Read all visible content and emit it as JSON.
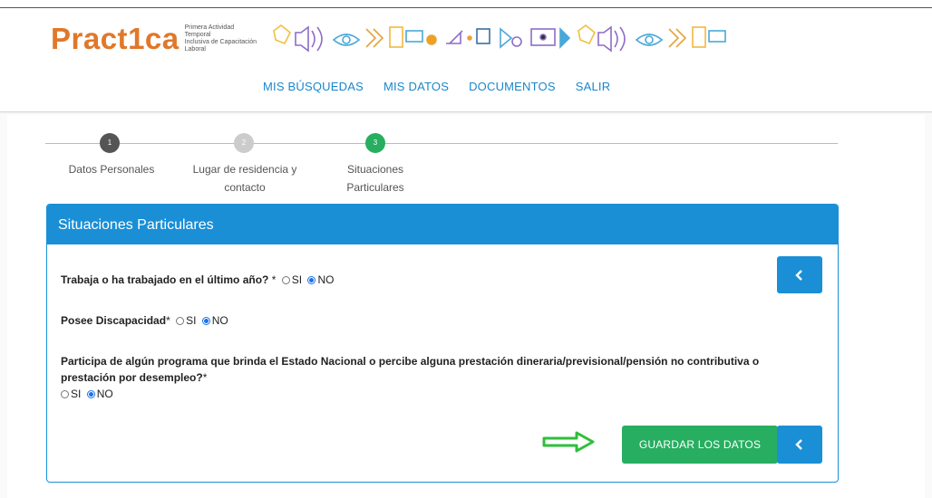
{
  "brand": {
    "name_a": "Pract",
    "name_b": "1",
    "name_c": "ca",
    "tagline_1": "Primera Actividad Temporal",
    "tagline_2": "Inclusiva de Capacitación Laboral"
  },
  "nav": {
    "items": [
      {
        "label": "MIS BÚSQUEDAS"
      },
      {
        "label": "MIS DATOS"
      },
      {
        "label": "DOCUMENTOS"
      },
      {
        "label": "SALIR"
      }
    ]
  },
  "stepper": {
    "steps": [
      {
        "number": "1",
        "label_1": "Datos Personales",
        "label_2": "",
        "state": "done",
        "color": "#555555"
      },
      {
        "number": "2",
        "label_1": "Lugar de residencia y",
        "label_2": "contacto",
        "state": "pending",
        "color": "#cccccc"
      },
      {
        "number": "3",
        "label_1": "Situaciones",
        "label_2": "Particulares",
        "state": "active",
        "color": "#27ae60"
      }
    ]
  },
  "panel": {
    "title": "Situaciones Particulares",
    "q1": {
      "label": "Trabaja o ha trabajado en el último año?",
      "required": " *",
      "opt_yes": "SI",
      "opt_no": "NO",
      "selected": "NO"
    },
    "q2": {
      "label": "Posee Discapacidad",
      "required": "*",
      "opt_yes": "SI",
      "opt_no": "NO",
      "selected": "NO"
    },
    "q3": {
      "label_1": "Participa de algún programa que brinda el Estado Nacional o percibe alguna prestación dineraria/previsional/pensión no contributiva o",
      "label_2": "prestación por desempleo?",
      "required": "*",
      "opt_yes": "SI",
      "opt_no": "NO",
      "selected": "NO"
    },
    "save_label": "GUARDAR LOS DATOS"
  },
  "colors": {
    "primary": "#1a8fd6",
    "success": "#27ae60",
    "brand": "#e0782a"
  },
  "icons": {
    "back": "chevron-left-icon",
    "hint": "arrow-right-icon"
  }
}
